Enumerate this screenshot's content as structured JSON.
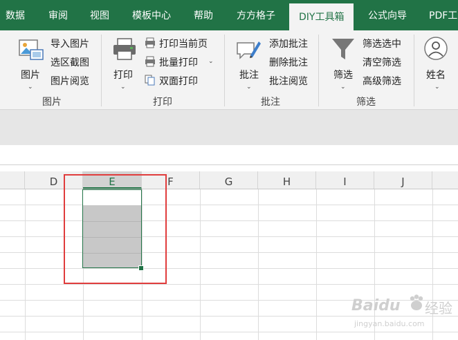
{
  "tabs": [
    "数据",
    "审阅",
    "视图",
    "模板中心",
    "帮助",
    "方方格子",
    "DIY工具箱",
    "公式向导",
    "PDF工"
  ],
  "active_tab": "DIY工具箱",
  "ribbon": {
    "picture_group": {
      "big_button": "图片",
      "items": [
        "导入图片",
        "选区截图",
        "图片阅览"
      ],
      "label": "图片"
    },
    "print_group": {
      "big_button": "打印",
      "items": [
        "打印当前页",
        "批量打印",
        "双面打印"
      ],
      "label": "打印"
    },
    "comment_group": {
      "big_button": "批注",
      "items": [
        "添加批注",
        "删除批注",
        "批注阅览"
      ],
      "label": "批注"
    },
    "filter_group": {
      "big_button": "筛选",
      "items": [
        "筛选选中",
        "清空筛选",
        "高级筛选"
      ],
      "label": "筛选"
    },
    "name_group": {
      "big_button": "姓名"
    }
  },
  "columns": [
    "D",
    "E",
    "F",
    "G",
    "H",
    "I",
    "J"
  ],
  "selected_column": "E",
  "watermark": {
    "brand": "Baidu",
    "brand_cn": "经验",
    "url": "jingyan.baidu.com"
  },
  "colors": {
    "accent": "#217346",
    "highlight_box": "#e03c3c",
    "selection_fill": "#c8c8c8"
  }
}
